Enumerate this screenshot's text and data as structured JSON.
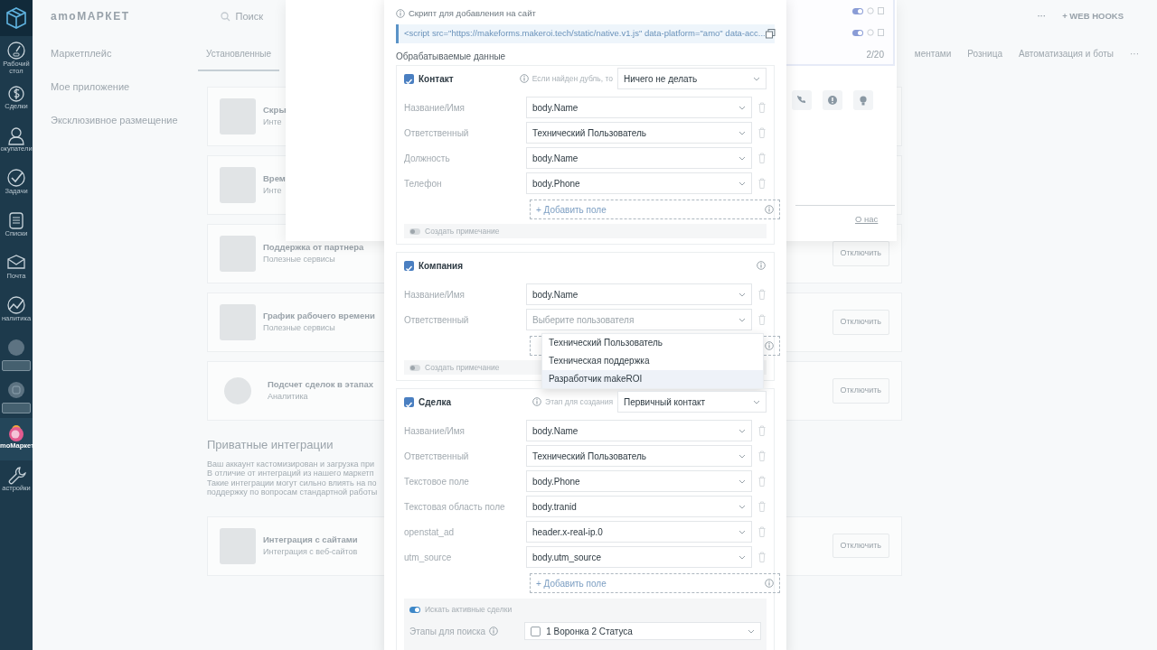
{
  "sidebar": {
    "items": [
      {
        "kind": "nav",
        "label": "Рабочий стол",
        "selected": false
      },
      {
        "kind": "nav",
        "label": "Сделки",
        "selected": false
      },
      {
        "kind": "nav",
        "label": "окупатели",
        "selected": false
      },
      {
        "kind": "nav",
        "label": "Задачи",
        "selected": false
      },
      {
        "kind": "nav",
        "label": "Списки",
        "selected": false
      },
      {
        "kind": "nav",
        "label": "Почта",
        "selected": false
      },
      {
        "kind": "nav",
        "label": "налитика",
        "selected": false
      },
      {
        "kind": "widget",
        "selected": false
      },
      {
        "kind": "widget",
        "selected": false
      },
      {
        "kind": "nav",
        "label": "moМаркет",
        "selected": true
      },
      {
        "kind": "nav",
        "label": "астройки",
        "selected": false
      }
    ]
  },
  "header": {
    "logo": "amoМАРКЕТ",
    "search": {
      "placeholder": "Поиск"
    },
    "more": "···",
    "webhooks": "+ WEB HOOKS"
  },
  "left_menu": [
    {
      "label": "Маркетплейс"
    },
    {
      "label": "Мое приложение"
    },
    {
      "label": "Эксклюзивное размещение"
    }
  ],
  "tabs": [
    {
      "label": "Установленные",
      "selected": true
    },
    {
      "label": "ментами",
      "selected": false
    },
    {
      "label": "Розница",
      "selected": false
    },
    {
      "label": "Автоматизация и боты",
      "selected": false
    },
    {
      "label": "···",
      "selected": false
    }
  ],
  "installed": [
    {
      "title": "Скры",
      "subtitle": "Инте"
    },
    {
      "title": "Врем",
      "subtitle": "Инте"
    },
    {
      "title": "Поддержка от партнера",
      "subtitle": "Полезные сервисы",
      "button": "Отключить"
    },
    {
      "title": "График рабочего времени",
      "subtitle": "Полезные сервисы",
      "button": "Отключить"
    },
    {
      "title": "Подсчет сделок в этапах",
      "subtitle": "Аналитика",
      "button": "Отключить"
    }
  ],
  "private": {
    "title": "Приватные интеграции",
    "text": [
      "Ваш аккаунт кастомизирован и загрузка при",
      "В отличие от интеграций из нашего маркетп",
      "Такие интеграции могут сильно влиять на по",
      "поддержку по вопросам стандартной работы"
    ],
    "cards": [
      {
        "title": "Интеграция с сайтами",
        "subtitle": "Интеграция с веб-сайтов",
        "button": "Отключить"
      }
    ]
  },
  "side_popup": {
    "toggles": [
      {
        "on": true
      },
      {
        "on": true
      }
    ],
    "counter": "2/20",
    "link": "О нас"
  },
  "modal": {
    "script": {
      "label": "Скрипт для добавления на сайт",
      "code": "<script src=\"https://makeforms.makeroi.tech/static/native.v1.js\" data-platform=\"amo\" data-acc..."
    },
    "section_title": "Обрабатываемые данные",
    "sections": [
      {
        "title": "Контакт",
        "checked": true,
        "option_label": "Если найден дубль, то",
        "option_value": "Ничего не делать",
        "fields": [
          {
            "label": "Название/Имя",
            "value": "body.Name"
          },
          {
            "label": "Ответственный",
            "value": "Технический Пользователь"
          },
          {
            "label": "Должность",
            "value": "body.Name"
          },
          {
            "label": "Телефон",
            "value": "body.Phone"
          }
        ],
        "add_field": {
          "kind": "full",
          "label": "+ Добавить поле"
        },
        "toggle": {
          "label": "Создать примечание",
          "on": false
        }
      },
      {
        "title": "Компания",
        "checked": true,
        "fields": [
          {
            "label": "Название/Имя",
            "value": "body.Name"
          },
          {
            "label": "Ответственный",
            "placeholder": "Выберите пользователя"
          }
        ],
        "add_field": {
          "kind": "covered"
        },
        "toggle": {
          "label": "Создать примечание",
          "on": false
        },
        "dropdown": {
          "options": [
            {
              "label": "Технический Пользователь",
              "selected": false
            },
            {
              "label": "Техническая поддержка",
              "selected": false
            },
            {
              "label": "Разработчик makeROI",
              "selected": true
            }
          ]
        }
      },
      {
        "title": "Сделка",
        "checked": true,
        "option_label": "Этап для создания",
        "option_value": "Первичный контакт",
        "fields": [
          {
            "label": "Название/Имя",
            "value": "body.Name"
          },
          {
            "label": "Ответственный",
            "value": "Технический Пользователь"
          },
          {
            "label": "Текстовое поле",
            "value": "body.Phone"
          },
          {
            "label": "Текстовая область поле",
            "value": "body.tranid"
          },
          {
            "label": "openstat_ad",
            "value": "header.x-real-ip.0"
          },
          {
            "label": "utm_source",
            "value": "body.utm_source"
          }
        ],
        "add_field": {
          "kind": "full",
          "label": "+ Добавить поле"
        },
        "toggle": {
          "label": "Искать активные сделки",
          "on": true
        },
        "search_stages": {
          "label": "Этапы для поиска",
          "value": "1 Воронка 2 Статуса",
          "checked": false
        }
      }
    ]
  }
}
